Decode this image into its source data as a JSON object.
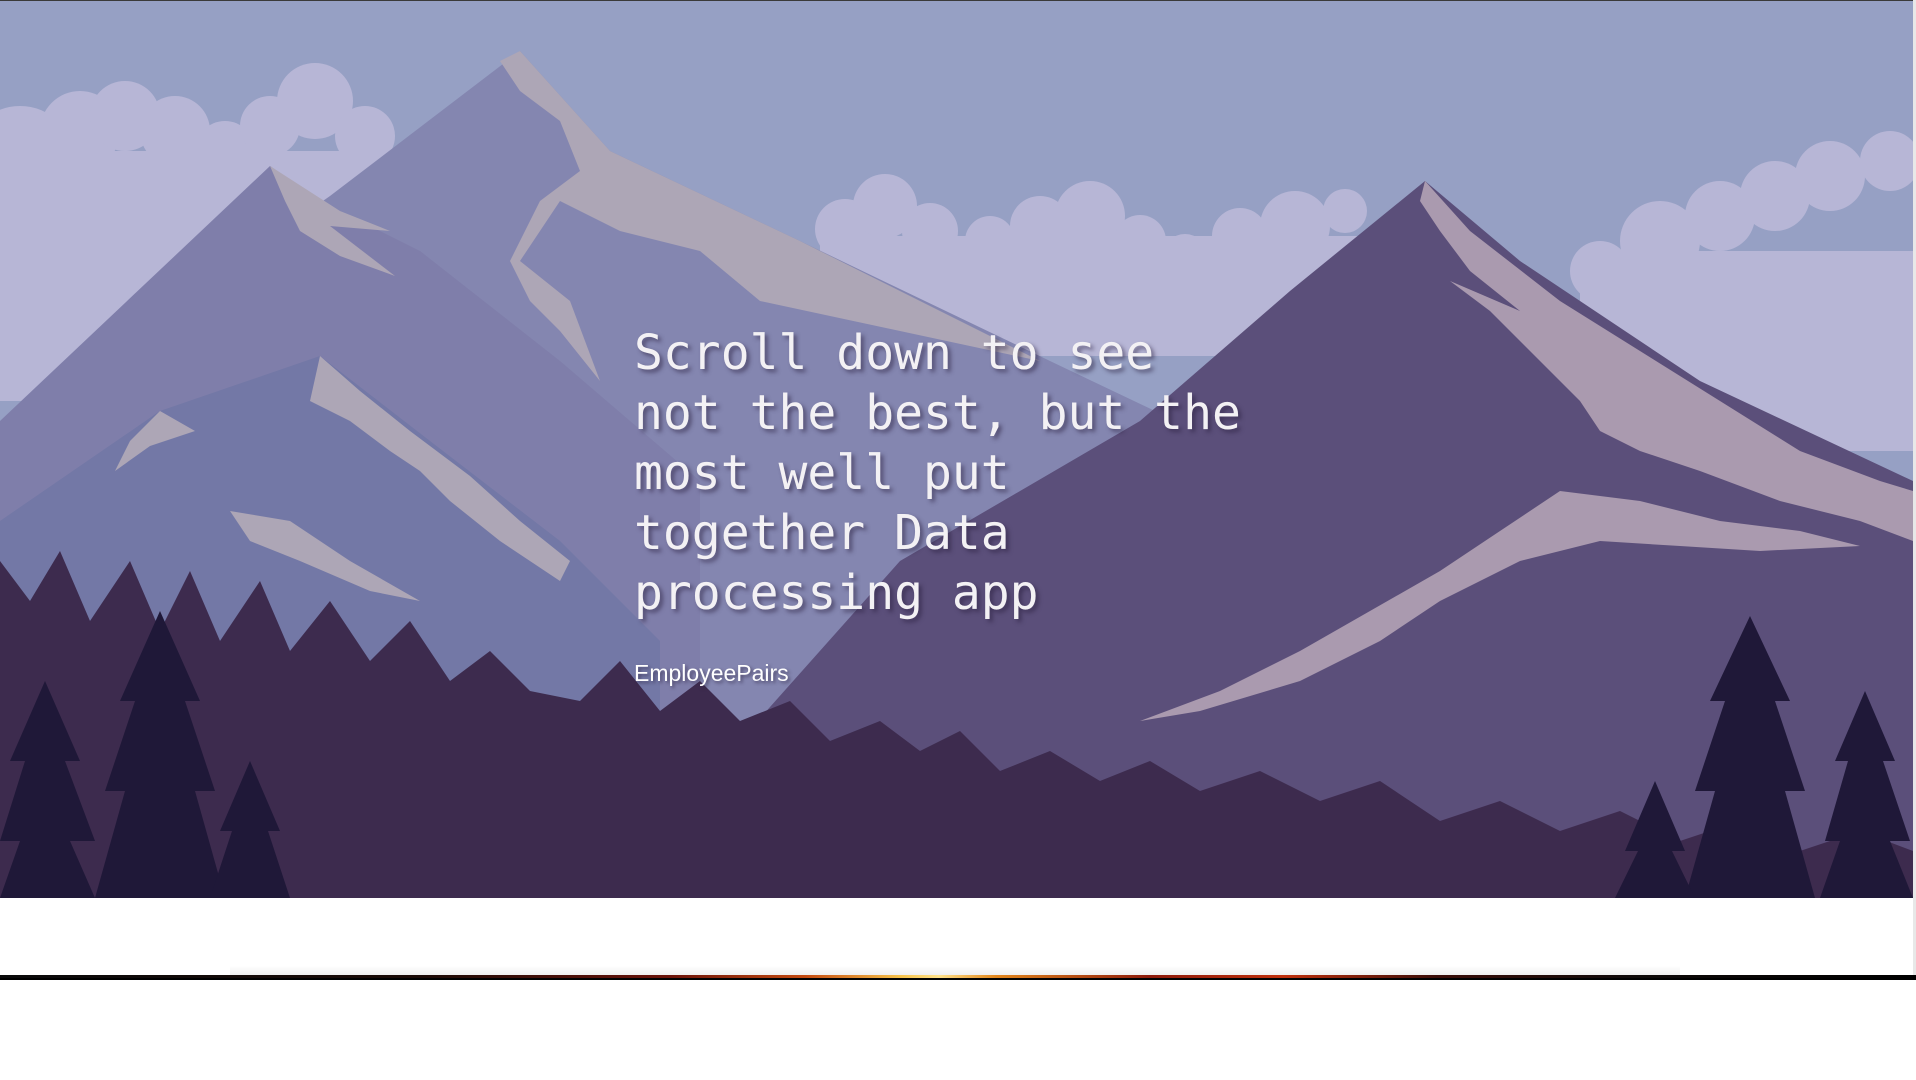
{
  "hero": {
    "headline_lines": [
      "Scroll down to see",
      "not the best, but the",
      "most well put",
      "together Data",
      "processing app"
    ],
    "subtitle": "EmployeePairs"
  },
  "colors": {
    "sky": "#96a0c4",
    "clouds": "#b7b6d6",
    "far_mountain": "#8486b0",
    "near_mountain": "#5b4f7a",
    "snow": "#ada6b6",
    "forest": "#3d2b4e",
    "trees": "#1f1838",
    "headline_text": "#f3f1f4",
    "fire_accent": "#f6c24a"
  },
  "illustration": {
    "name": "mountain-landscape-background",
    "elements": [
      "sky",
      "clouds",
      "mountains",
      "snow-caps",
      "pine-forest"
    ]
  }
}
